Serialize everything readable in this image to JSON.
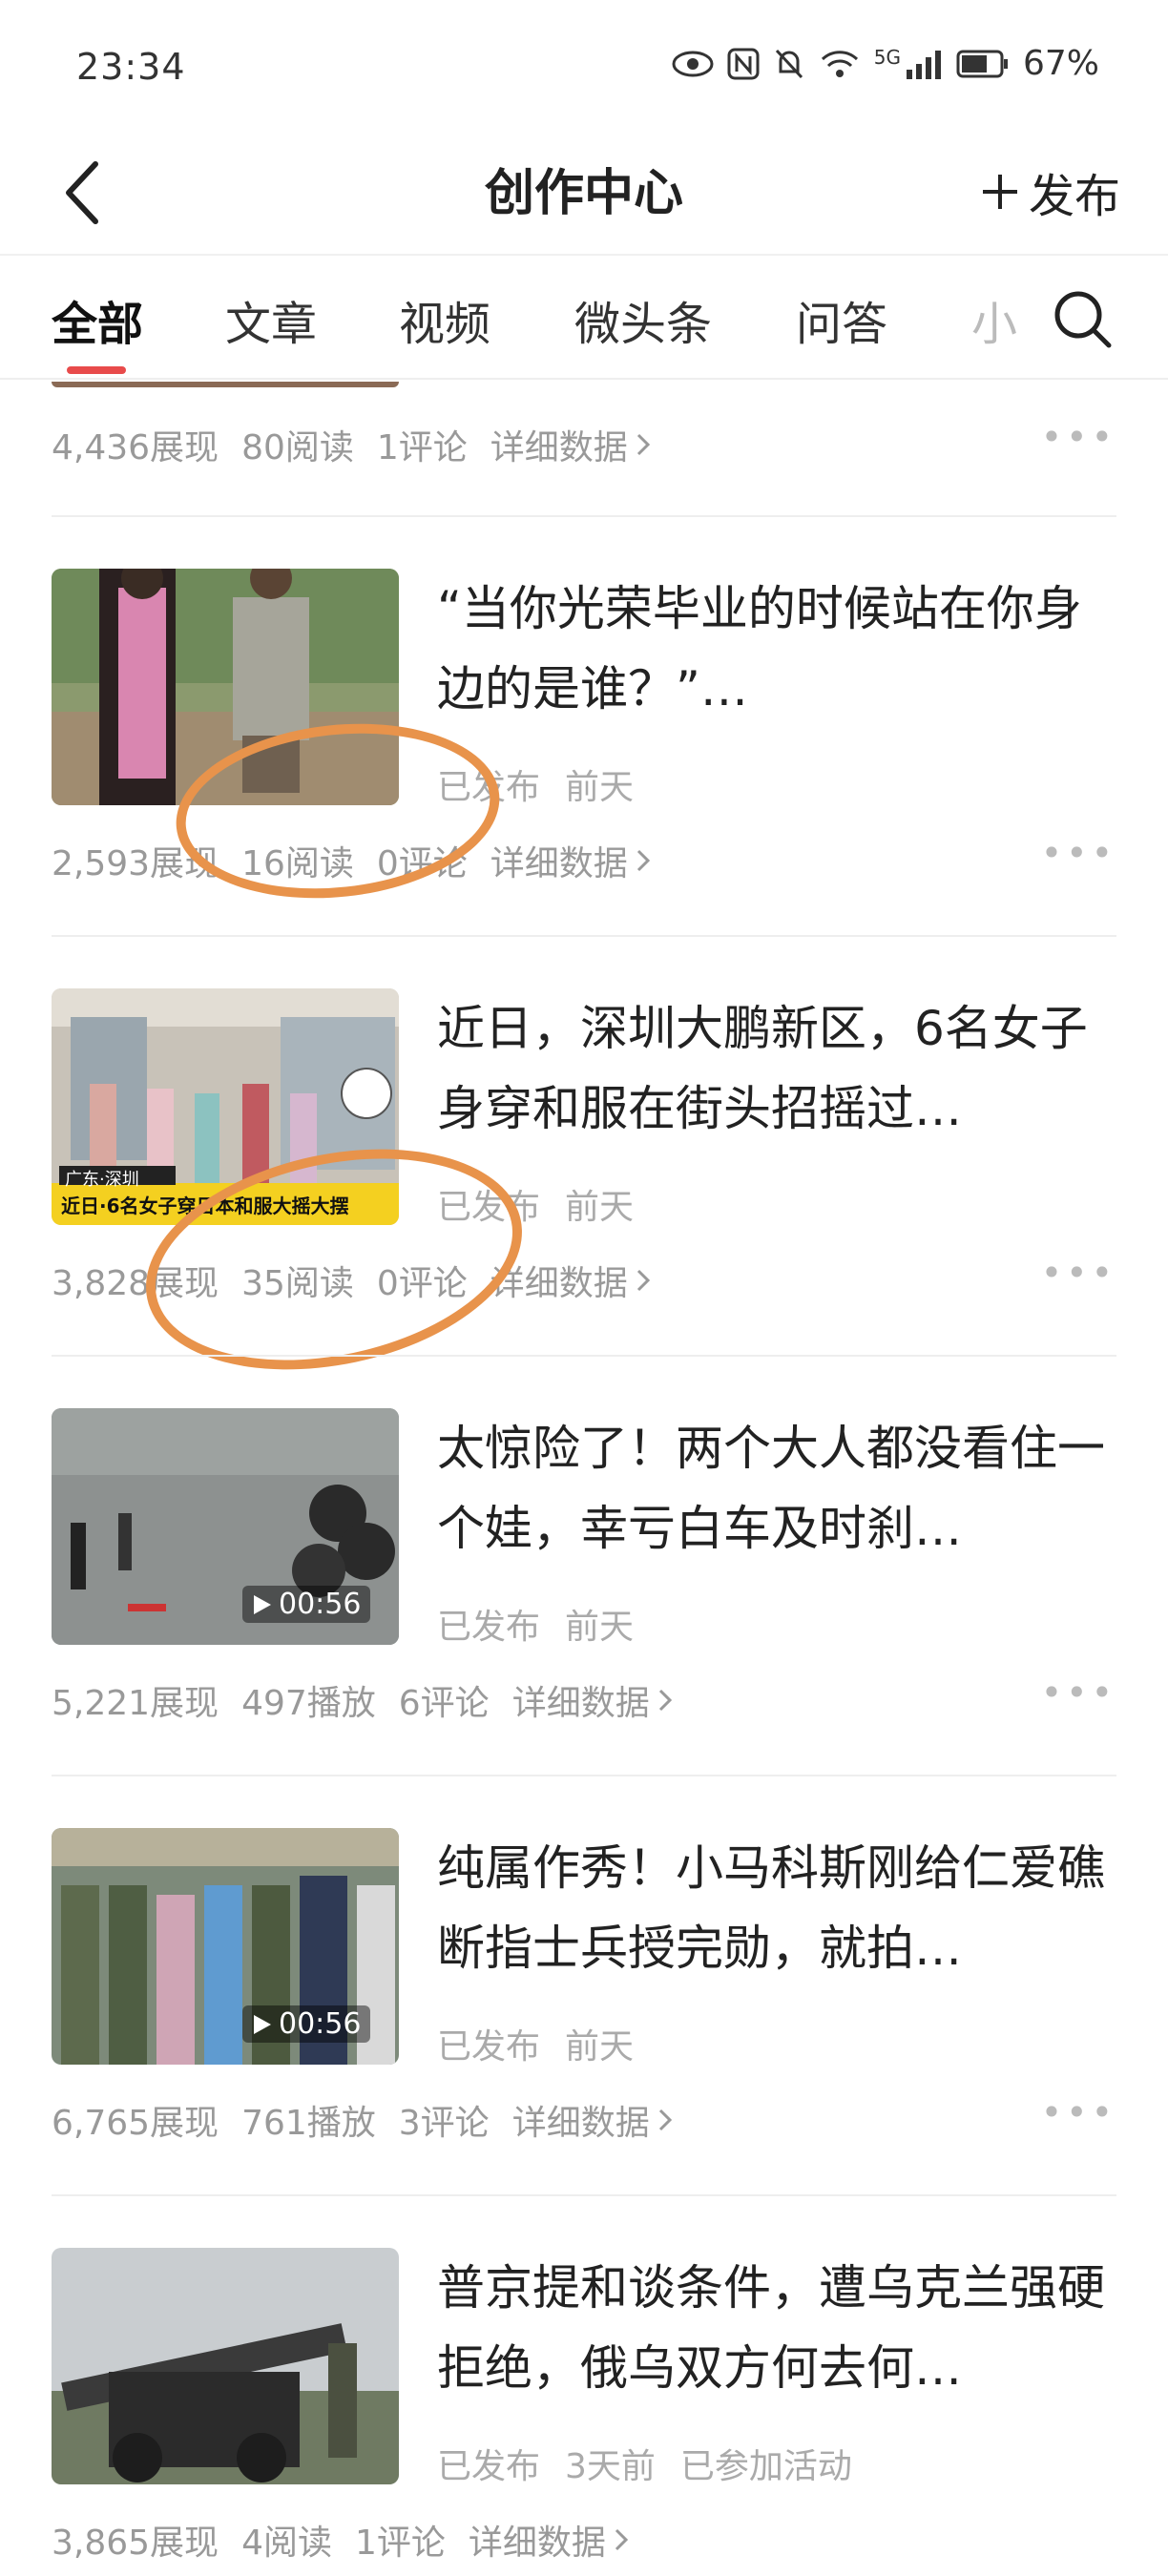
{
  "status_bar": {
    "time": "23:34",
    "battery": "67%",
    "signal": "5G"
  },
  "nav": {
    "title": "创作中心",
    "publish_label": "发布"
  },
  "tabs": [
    {
      "label": "全部"
    },
    {
      "label": "文章"
    },
    {
      "label": "视频"
    },
    {
      "label": "微头条"
    },
    {
      "label": "问答"
    },
    {
      "label": "小"
    }
  ],
  "top_stats": {
    "impressions": "4,436展现",
    "reads": "80阅读",
    "comments": "1评论",
    "detail": "详细数据"
  },
  "items": [
    {
      "title": "“当你光荣毕业的时候站在你身边的是谁？”…",
      "status": "已发布",
      "time": "前天",
      "impressions": "2,593展现",
      "reads": "16阅读",
      "comments": "0评论",
      "detail": "详细数据"
    },
    {
      "title": "近日，深圳大鹏新区，6名女子身穿和服在街头招摇过…",
      "status": "已发布",
      "time": "前天",
      "thumb_tag": "广东·深圳",
      "thumb_caption": "近日·6名女子穿日本和服大摇大摆",
      "impressions": "3,828展现",
      "reads": "35阅读",
      "comments": "0评论",
      "detail": "详细数据"
    },
    {
      "title": "太惊险了！两个大人都没看住一个娃，幸亏白车及时刹…",
      "status": "已发布",
      "time": "前天",
      "duration": "00:56",
      "impressions": "5,221展现",
      "reads": "497播放",
      "comments": "6评论",
      "detail": "详细数据"
    },
    {
      "title": "纯属作秀！小马科斯刚给仁爱礁断指士兵授完勋，就拍…",
      "status": "已发布",
      "time": "前天",
      "duration": "00:56",
      "impressions": "6,765展现",
      "reads": "761播放",
      "comments": "3评论",
      "detail": "详细数据"
    },
    {
      "title": "普京提和谈条件，遭乌克兰强硬拒绝，俄乌双方何去何…",
      "status": "已发布",
      "time": "3天前",
      "extra": "已参加活动",
      "impressions": "3,865展现",
      "reads": "4阅读",
      "comments": "1评论",
      "detail": "详细数据"
    }
  ]
}
